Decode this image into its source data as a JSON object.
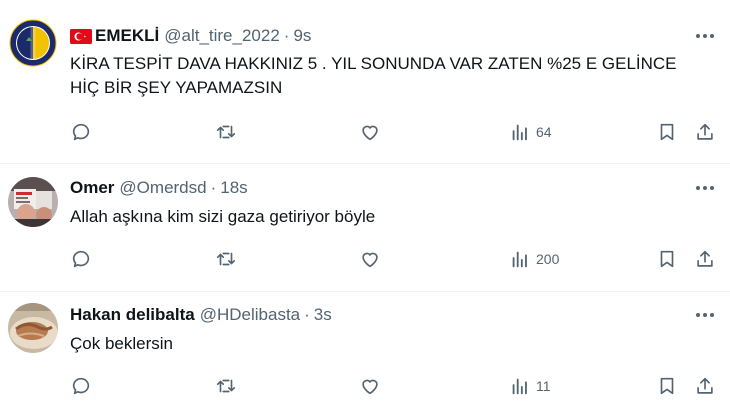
{
  "tweets": [
    {
      "display_name": "EMEKLİ",
      "handle": "@alt_tire_2022",
      "separator": "·",
      "time": "9s",
      "text_lines": [
        "KİRA TESPİT DAVA HAKKINIZ 5 . YIL SONUNDA VAR ZATEN %25 E GELİNCE",
        "HİÇ BİR ŞEY YAPAMAZSIN"
      ],
      "views": "64",
      "avatar": "fenerbahce-crest",
      "has_flag": true
    },
    {
      "display_name": "Omer",
      "handle": "@Omerdsd",
      "separator": "·",
      "time": "18s",
      "text_lines": [
        "Allah aşkına kim sizi gaza getiriyor böyle"
      ],
      "views": "200",
      "avatar": "protest-photo"
    },
    {
      "display_name": "Hakan delibalta",
      "handle": "@HDelibasta",
      "separator": "·",
      "time": "3s",
      "text_lines": [
        "Çok beklersin"
      ],
      "views": "11",
      "avatar": "food-photo"
    }
  ],
  "icons": {
    "reply": "reply-icon",
    "retweet": "retweet-icon",
    "like": "heart-icon",
    "views": "views-icon",
    "bookmark": "bookmark-icon",
    "share": "share-icon",
    "more": "more-icon"
  },
  "colors": {
    "text": "#0f1419",
    "secondary": "#536471",
    "divider": "#eff3f4",
    "flag_red": "#e30a17",
    "crest_navy": "#1b2a6b",
    "crest_yellow": "#f2c200"
  }
}
